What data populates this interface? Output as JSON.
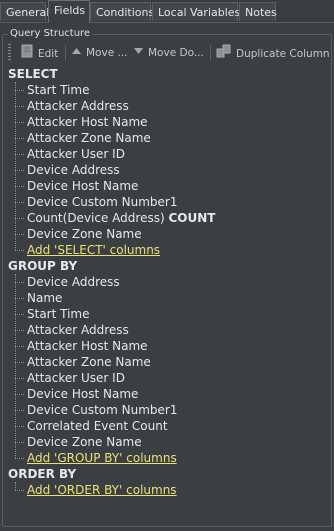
{
  "tabs": [
    {
      "label": "General",
      "active": false
    },
    {
      "label": "Fields",
      "active": true
    },
    {
      "label": "Conditions",
      "active": false
    },
    {
      "label": "Local Variables",
      "active": false
    },
    {
      "label": "Notes",
      "active": false
    }
  ],
  "query_structure": {
    "title": "Query Structure",
    "toolbar": {
      "edit": "Edit",
      "move_up": "Move ...",
      "move_down": "Move Do...",
      "duplicate": "Duplicate Column"
    }
  },
  "select": {
    "header": "SELECT",
    "items": [
      "Start Time",
      "Attacker Address",
      "Attacker Host Name",
      "Attacker Zone Name",
      "Attacker User ID",
      "Device Address",
      "Device Host Name",
      "Device Custom Number1"
    ],
    "count_item": {
      "text": "Count(Device Address)",
      "alias": "COUNT"
    },
    "items_after": [
      "Device Zone Name"
    ],
    "add_link": "Add 'SELECT' columns"
  },
  "group_by": {
    "header": "GROUP BY",
    "items": [
      "Device Address",
      "Name",
      "Start Time",
      "Attacker Address",
      "Attacker Host Name",
      "Attacker Zone Name",
      "Attacker User ID",
      "Device Host Name",
      "Device Custom Number1",
      "Correlated Event Count",
      "Device Zone Name"
    ],
    "add_link": "Add 'GROUP BY' columns"
  },
  "order_by": {
    "header": "ORDER BY",
    "add_link": "Add 'ORDER BY' columns"
  },
  "colors": {
    "background": "#3c3f41",
    "text": "#e8e8e8",
    "link": "#e8e27a",
    "border": "#5a5d60"
  }
}
